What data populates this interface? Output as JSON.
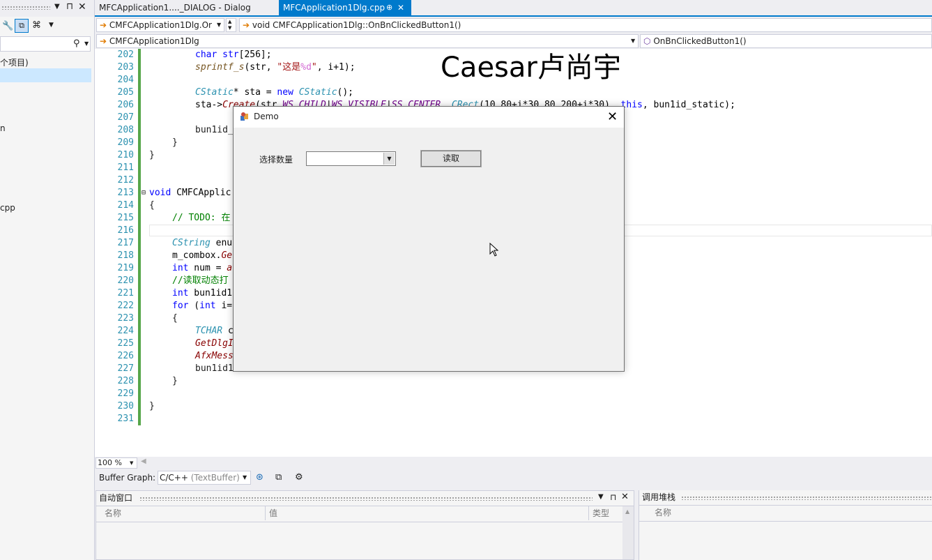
{
  "left_panel": {
    "tree_items": [
      "个项目)",
      "n",
      "cpp"
    ]
  },
  "tabs": [
    {
      "label": "MFCApplication1...._DIALOG - Dialog"
    },
    {
      "label": "MFCApplication1Dlg.cpp",
      "pin": "⊕",
      "close": "✕"
    }
  ],
  "nav1": {
    "file_combo": "CMFCApplication1Dlg.Or",
    "member_combo": "void CMFCApplication1Dlg::OnBnClickedButton1()"
  },
  "nav2": {
    "class_combo": "CMFCApplication1Dlg",
    "func_combo": "OnBnClickedButton1()"
  },
  "watermark": "Caesar卢尚宇",
  "line_numbers": [
    "202",
    "203",
    "204",
    "205",
    "206",
    "207",
    "208",
    "209",
    "210",
    "211",
    "212",
    "213",
    "214",
    "215",
    "216",
    "217",
    "218",
    "219",
    "220",
    "221",
    "222",
    "223",
    "224",
    "225",
    "226",
    "227",
    "228",
    "229",
    "230",
    "231"
  ],
  "code": {
    "l202a": "char str",
    "l202b": "[256]",
    "l202c": ";",
    "l203a": "sprintf_s",
    "l203b": "(str, ",
    "l203c": "\"这是",
    "l203d": "%d",
    "l203e": "\"",
    "l203f": ", i+1",
    "l203g": ");",
    "l205a": "CStatic",
    "l205b": "* sta = ",
    "l205c": "new",
    "l205d": " ",
    "l205e": "CStatic",
    "l205f": "();",
    "l206a": "sta->",
    "l206b": "Create",
    "l206c": "(str,",
    "l206d": "WS_CHILD",
    "l206e": "|",
    "l206f": "WS_VISIBLE",
    "l206g": "|",
    "l206h": "SS_CENTER",
    "l206i": ", ",
    "l206j": "CRect",
    "l206k": "(10,80+i*30,80,200+i*30),",
    "l206l": " this",
    "l206m": ", bun1id_static);",
    "l208": "bun1id_",
    "l209": "}",
    "l210": "}",
    "l213a": "void",
    "l213b": " CMFCApplic",
    "l214": "{",
    "l215": "// TODO: 在",
    "l217a": "CString",
    "l217b": " enu",
    "l218a": "m_combox.",
    "l218b": "Ge",
    "l219a": "int",
    "l219b": " num = ",
    "l219c": "a",
    "l220": "//读取动态打",
    "l221a": "int",
    "l221b": " bun1id1",
    "l222a": "for",
    "l222b": " (",
    "l222c": "int",
    "l222d": " i=",
    "l223": "{",
    "l224a": "TCHAR",
    "l224b": " c",
    "l225": "GetDlgI",
    "l226": "AfxMess",
    "l227": "bun1id1",
    "l228": "}",
    "l230": "}"
  },
  "zoom": "100 %",
  "buffer_bar": {
    "label": "Buffer Graph:",
    "combo": "C/C++",
    "combo_hint": "(TextBuffer)"
  },
  "auto_pane": {
    "title": "自动窗口",
    "col_name": "名称",
    "col_value": "值",
    "col_type": "类型"
  },
  "stack_pane": {
    "title": "调用堆栈",
    "col_name": "名称"
  },
  "dialog": {
    "title": "Demo",
    "close": "✕",
    "label": "选择数量",
    "button": "读取",
    "combo_value": ""
  }
}
